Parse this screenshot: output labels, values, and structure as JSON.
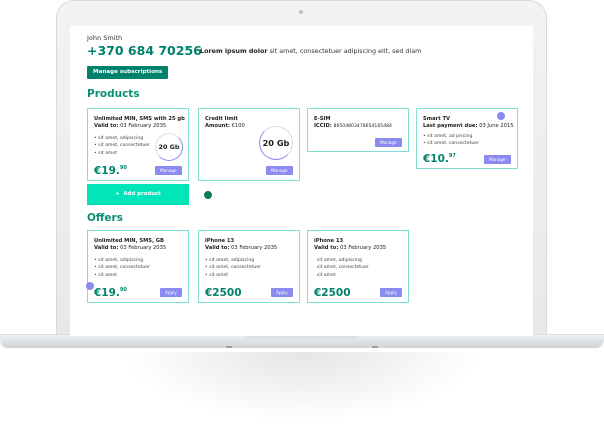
{
  "account": {
    "user_name": "John Smith",
    "phone": "+370 684 70256",
    "promo_bold": "Lorem ipsum dolor",
    "promo_text": " sit amet, consectetuer adipiscing elit, sed diam",
    "manage_subscriptions_label": "Manage subscriptions"
  },
  "products": {
    "title": "Products",
    "add_product_label": "Add product",
    "add_product_icon": "+",
    "items": [
      {
        "title": "Unlimited MIN, SMS with 25 gb",
        "valid_label": "Valid to:",
        "valid_value": "03 February 2035",
        "bullets": [
          "sit amet, adipiscing",
          "sit amet, consectetuer",
          "sit amet"
        ],
        "ring_text": "20 Gb",
        "price": "€19.",
        "price_cents": "90",
        "button": "Manage"
      },
      {
        "title": "Credit limit",
        "amount_label": "Amount:",
        "amount_value": "€100",
        "ring_text": "20 Gb",
        "button": "Manage"
      },
      {
        "title": "E-SIM",
        "iccid_label": "ICCID:",
        "iccid_value": "86504803478654165484",
        "button": "Manage"
      },
      {
        "title": "Smart TV",
        "due_label": "Last payment due:",
        "due_value": "03 June 2015",
        "bullets": [
          "sit amet, ad piscing",
          "sit amet, consectetuer"
        ],
        "price": "€10.",
        "price_cents": "97",
        "button": "Manage"
      }
    ]
  },
  "offers": {
    "title": "Offers",
    "items": [
      {
        "title": "Unlimited MIN, SMS, GB",
        "valid_label": "Valid to:",
        "valid_value": "03 February 2035",
        "bullets": [
          "sit amet, adipiscing",
          "sit amet, consectetuer",
          "sit amet"
        ],
        "price": "€19.",
        "price_cents": "90",
        "button": "Apply"
      },
      {
        "title": "iPhone 13",
        "valid_label": "Valid to:",
        "valid_value": "03 February 2035",
        "bullets": [
          "sit amet, adipiscing",
          "sit amet, consectetuer",
          "sit amet"
        ],
        "price": "€2500",
        "button": "Apply"
      },
      {
        "title": "iPhone 13",
        "valid_label": "Valid to:",
        "valid_value": "03 February 2035",
        "bullets": [
          "sit amet, adipiscing",
          "sit amet, consectetuer",
          "sit amet"
        ],
        "price": "€2500",
        "button": "Apply"
      }
    ]
  },
  "colors": {
    "brand_green": "#00816c",
    "card_border": "#7fe0d3",
    "accent_purple": "#8a8af0",
    "add_button": "#00e6b8"
  }
}
